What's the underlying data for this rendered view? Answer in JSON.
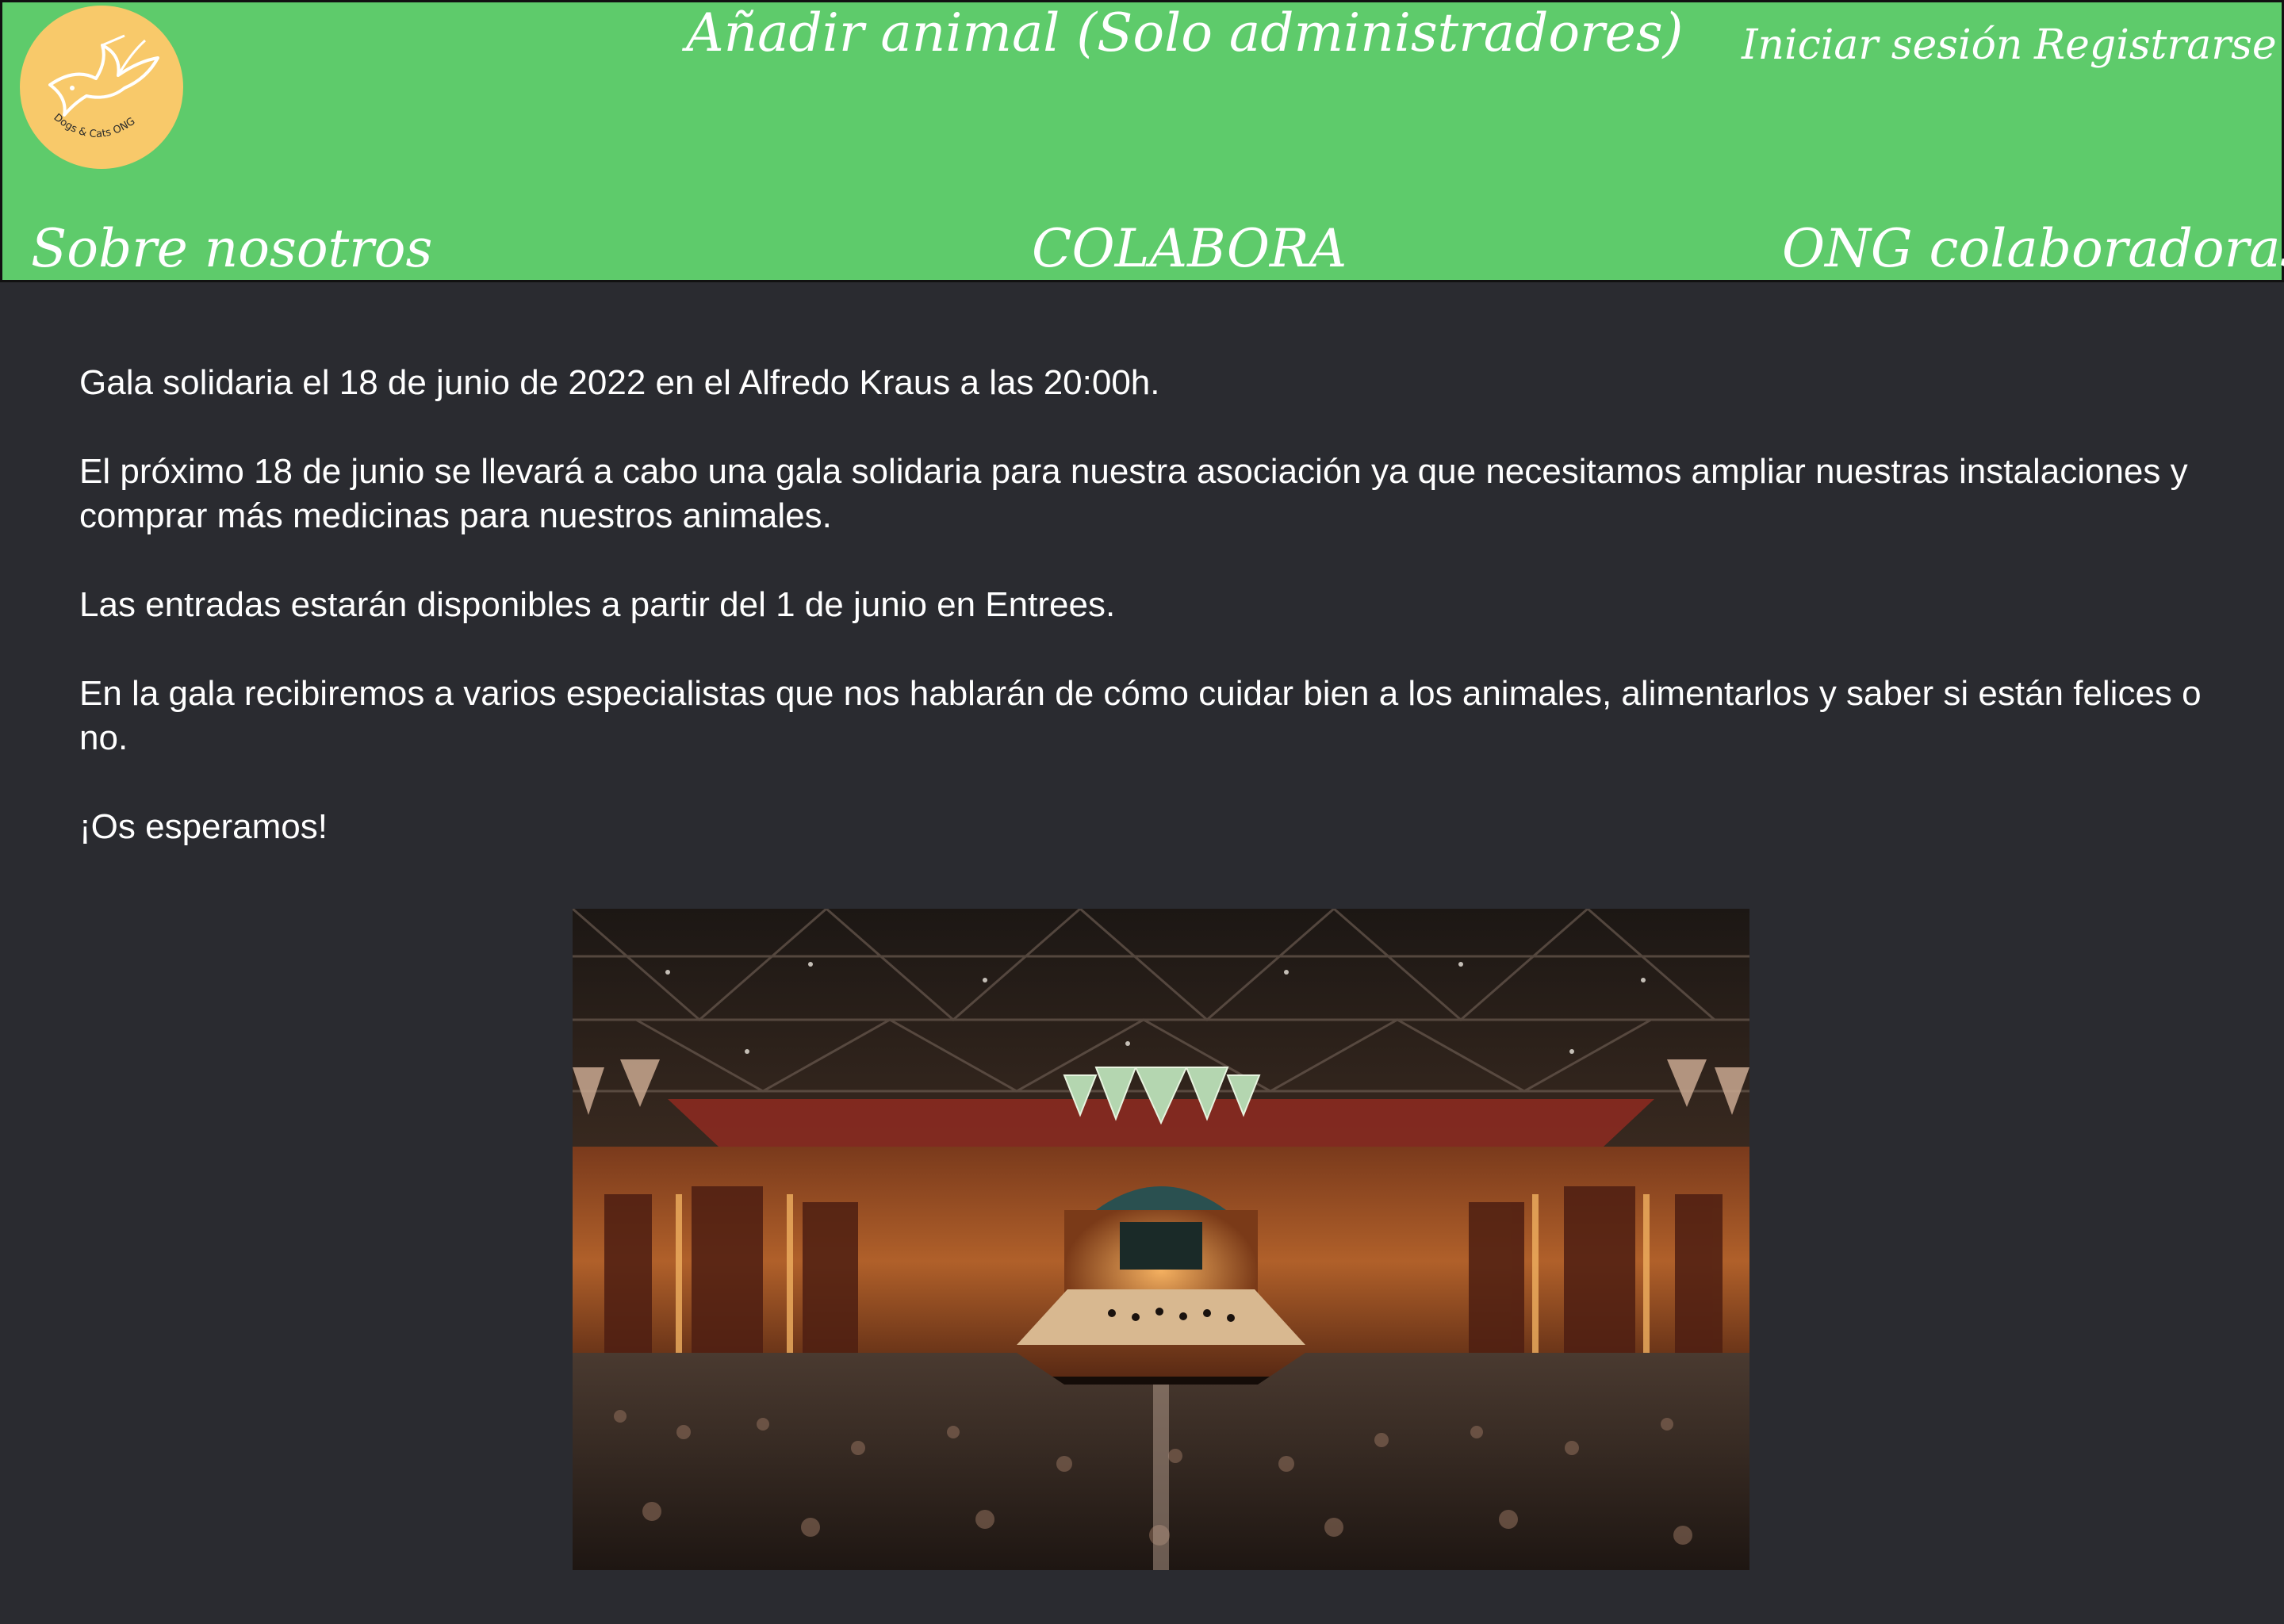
{
  "header": {
    "logo_text": "Dogs & Cats ONG",
    "admin_link": "Añadir animal (Solo administradores)",
    "login": "Iniciar sesión",
    "register": "Registrarse",
    "nav": {
      "about": "Sobre nosotros",
      "colabora": "COLABORA",
      "ong": "ONG colaboradoras"
    }
  },
  "article": {
    "paragraphs": [
      "Gala solidaria el 18 de junio de 2022 en el Alfredo Kraus a las 20:00h.",
      "El próximo 18 de junio se llevará a cabo una gala solidaria para nuestra asociación ya que necesitamos ampliar nuestras instalaciones y comprar más medicinas para nuestros animales.",
      "Las entradas estarán disponibles a partir del 1 de junio en Entrees.",
      "En la gala recibiremos a varios especialistas que nos hablarán de cómo cuidar bien a los animales, alimentarlos y saber si están felices o no.",
      "¡Os esperamos!"
    ]
  },
  "colors": {
    "header_bg": "#5ecb6b",
    "page_bg": "#2a2b30",
    "logo_bg": "#f8c96a",
    "text": "#ffffff"
  }
}
